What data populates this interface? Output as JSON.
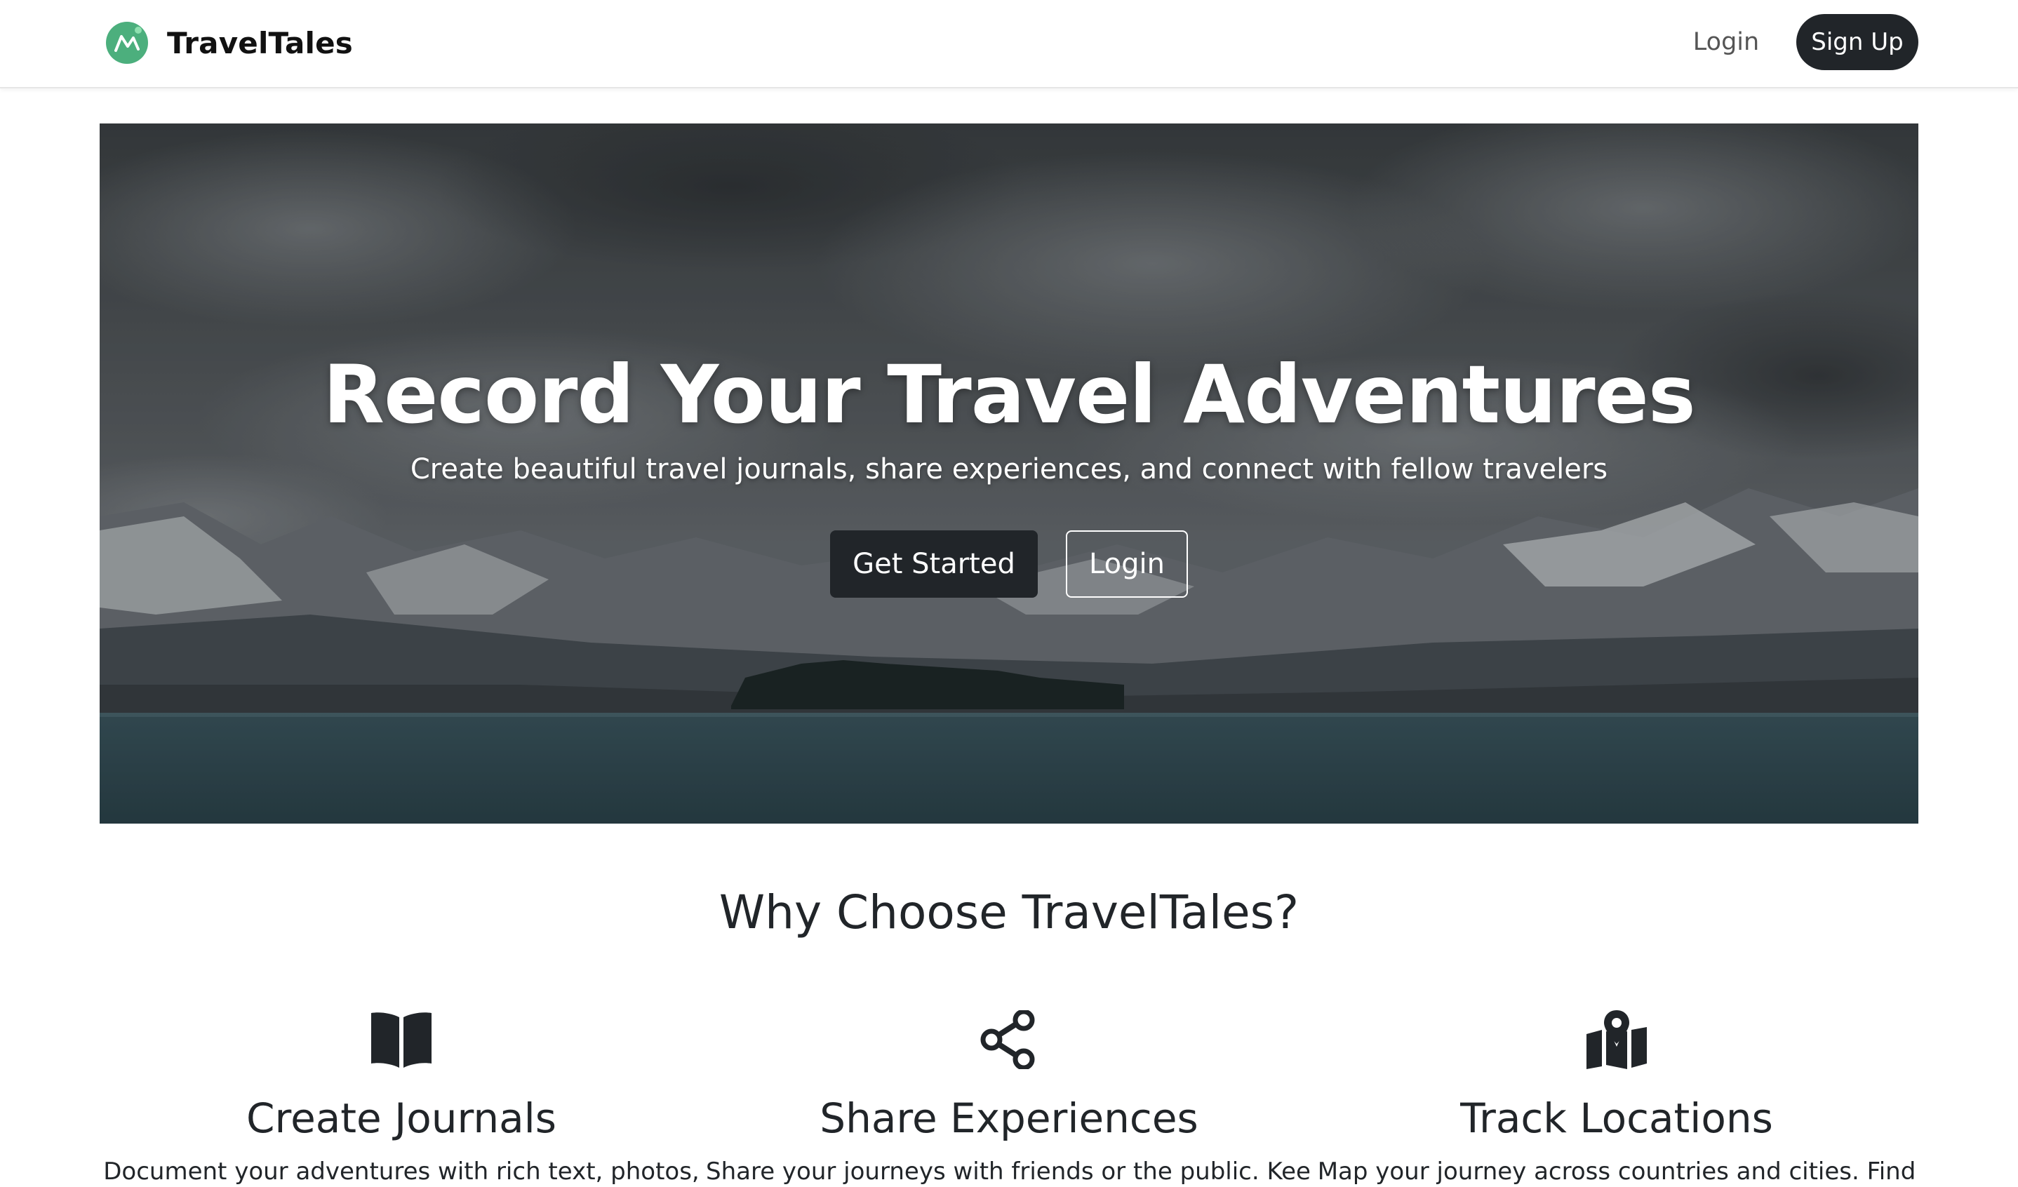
{
  "navbar": {
    "brand_name": "TravelTales",
    "login_label": "Login",
    "signup_label": "Sign Up"
  },
  "hero": {
    "title": "Record Your Travel Adventures",
    "subtitle": "Create beautiful travel journals, share experiences, and connect with fellow travelers",
    "primary_button": "Get Started",
    "secondary_button": "Login"
  },
  "features": {
    "heading": "Why Choose TravelTales?",
    "items": [
      {
        "icon": "book-open-icon",
        "title": "Create Journals",
        "description": "Document your adventures with rich text, photos,"
      },
      {
        "icon": "share-icon",
        "title": "Share Experiences",
        "description": "Share your journeys with friends or the public. Keep"
      },
      {
        "icon": "map-location-icon",
        "title": "Track Locations",
        "description": "Map your journey across countries and cities. Find"
      }
    ]
  },
  "colors": {
    "brand_green": "#4caf7d",
    "dark": "#212529",
    "white": "#ffffff"
  }
}
